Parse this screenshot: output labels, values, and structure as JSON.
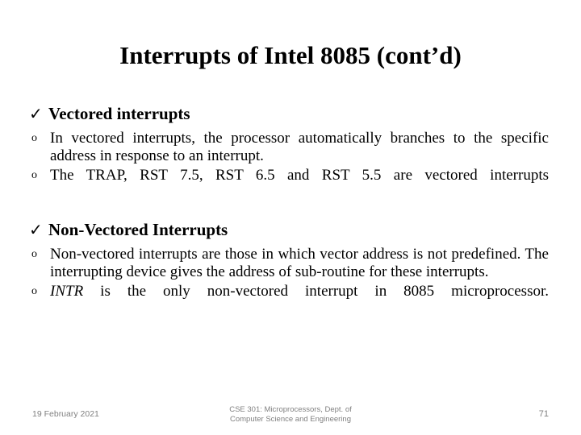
{
  "slide": {
    "title": "Interrupts of Intel 8085 (cont’d)",
    "background_color": "#ffffff",
    "text_color": "#000000"
  },
  "markers": {
    "level1": "✓",
    "level2": "o"
  },
  "content": {
    "sections": [
      {
        "heading": "Vectored interrupts",
        "bullets": [
          "In vectored interrupts, the processor automatically branches to the specific address in response to an interrupt.",
          "The TRAP, RST 7.5, RST 6.5 and RST 5.5 are vectored interrupts"
        ]
      },
      {
        "heading": "Non-Vectored Interrupts",
        "bullets": [
          "Non-vectored interrupts are those in which vector address is not predefined. The interrupting device gives the address of sub-routine for these interrupts.",
          "INTR is the only non-vectored interrupt in 8085 microprocessor."
        ],
        "bullet_italic_lead": [
          "",
          "INTR"
        ]
      }
    ]
  },
  "footer": {
    "date": "19 February 2021",
    "center_line1": "CSE 301: Microprocessors, Dept. of",
    "center_line2": "Computer Science and Engineering",
    "page_number": "71",
    "color": "#808080"
  }
}
